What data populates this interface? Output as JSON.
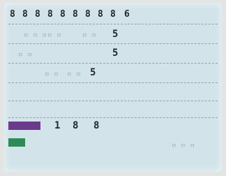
{
  "board": {
    "top_row": [
      "8",
      "8",
      "8",
      "8",
      "8",
      "8",
      "8",
      "8",
      "8",
      "6"
    ],
    "row1_value": "5",
    "row2_value": "5",
    "row3_value": "5"
  },
  "status": {
    "p1": "1",
    "p2": "8",
    "p3": "8"
  },
  "colors": {
    "screen": "#d2e4ea",
    "player_purple": "#6c3a8c",
    "player_green": "#2e8b57",
    "ink": "#23272a"
  }
}
